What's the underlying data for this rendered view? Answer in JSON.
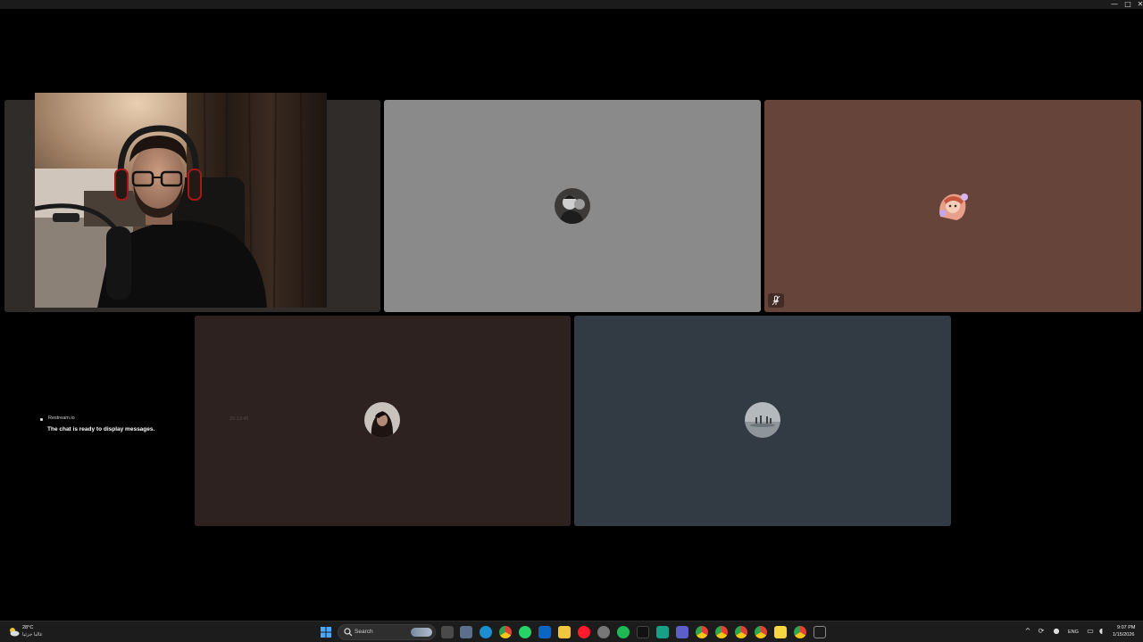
{
  "window": {
    "controls": [
      "—",
      "□",
      "✕"
    ]
  },
  "participants": [
    {
      "id": "p1",
      "background": "#2f2c29",
      "kind": "camera"
    },
    {
      "id": "p2",
      "background": "#8a8a8a",
      "kind": "avatar",
      "avatar_icon": "avatar-man-dark-icon"
    },
    {
      "id": "p3",
      "background": "#66443a",
      "kind": "avatar",
      "avatar_icon": "avatar-anime-girl-icon",
      "muted": true
    },
    {
      "id": "p4",
      "background": "#2d2220",
      "kind": "avatar",
      "avatar_icon": "avatar-woman-dark-icon",
      "timestamp": "20:13:45"
    },
    {
      "id": "p5",
      "background": "#323a44",
      "kind": "avatar",
      "avatar_icon": "avatar-landscape-icon"
    }
  ],
  "chat": {
    "source": "Restream.io",
    "message": "The chat is ready to display messages."
  },
  "taskbar": {
    "weather": {
      "temp": "28°C",
      "desc": "غالبا جزئيا",
      "icon": "partly-cloudy-icon"
    },
    "search": {
      "placeholder": "Search"
    },
    "tray": {
      "language": "ENG",
      "time": "9:07 PM",
      "date": "1/15/2026"
    }
  }
}
